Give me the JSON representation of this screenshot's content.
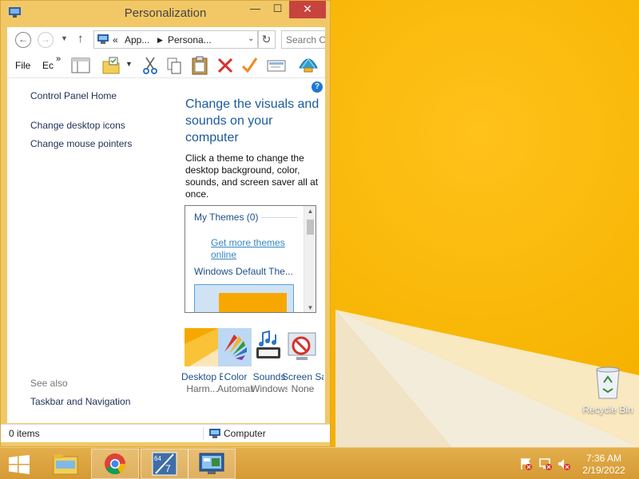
{
  "window": {
    "title": "Personalization",
    "controls": {
      "minimize": "—",
      "maximize": "☐",
      "close": "✕"
    }
  },
  "address": {
    "overflow": "«",
    "crumbs": [
      "App...",
      "Persona..."
    ],
    "search_placeholder": "Search C"
  },
  "toolbar": {
    "menus": [
      "File",
      "Ec"
    ],
    "overflow": "»",
    "icons": [
      "layout-pane-icon",
      "folder-options-icon",
      "cut-icon",
      "copy-icon",
      "paste-icon",
      "delete-icon",
      "check-icon",
      "properties-icon",
      "shell-icon"
    ]
  },
  "left_nav": {
    "home": "Control Panel Home",
    "links": [
      "Change desktop icons",
      "Change mouse pointers"
    ],
    "see_also_label": "See also",
    "see_also_links": [
      "Taskbar and Navigation"
    ]
  },
  "main": {
    "heading": "Change the visuals and sounds on your computer",
    "description": "Click a theme to change the desktop background, color, sounds, and screen saver all at once.",
    "themes": {
      "group_label": "My Themes (0)",
      "get_more": "Get more themes online",
      "default_theme": "Windows Default The..."
    },
    "tiles": [
      {
        "label": "Desktop Background",
        "sub": "Harm..."
      },
      {
        "label": "Color",
        "sub": "Automatic"
      },
      {
        "label": "Sounds",
        "sub": "Windows Default"
      },
      {
        "label": "Screen Saver",
        "sub": "None"
      }
    ]
  },
  "status": {
    "items": "0 items",
    "location": "Computer"
  },
  "desktop": {
    "recycle_bin": "Recycle Bin"
  },
  "taskbar": {
    "apps": [
      "file-explorer-icon",
      "chrome-icon",
      "app64-icon",
      "control-panel-icon"
    ],
    "time": "7:36 AM",
    "date": "2/19/2022"
  },
  "colors": {
    "accent": "#1c5a9c",
    "link": "#3487c7",
    "frame": "#f2c867",
    "desktop": "#f7b500",
    "close": "#c7433d"
  }
}
